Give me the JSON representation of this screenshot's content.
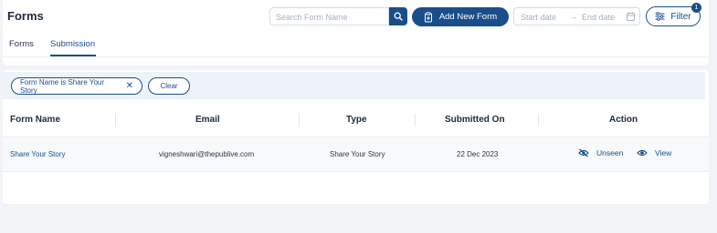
{
  "header": {
    "title": "Forms",
    "search_placeholder": "Search Form Name",
    "add_button_label": "Add New Form",
    "date_start_placeholder": "Start date",
    "date_end_placeholder": "End date",
    "filter_label": "Filter",
    "filter_count": "1"
  },
  "tabs": [
    {
      "label": "Forms",
      "active": false
    },
    {
      "label": "Submission",
      "active": true
    }
  ],
  "filters": {
    "chip_label": "Form Name is Share Your Story",
    "clear_label": "Clear"
  },
  "table": {
    "columns": [
      "Form Name",
      "Email",
      "Type",
      "Submitted On",
      "Action"
    ],
    "rows": [
      {
        "form_name": "Share Your Story",
        "email": "vigneshwari@thepublive.com",
        "type": "Share Your Story",
        "submitted_on": "22 Dec 2023",
        "unseen_label": "Unseen",
        "view_label": "View"
      }
    ]
  },
  "colors": {
    "accent": "#1a4e8a",
    "page_bg": "#f1f3f6",
    "chip_bar_bg": "#eef3f9"
  },
  "icons": [
    "search-icon",
    "add-form-icon",
    "arrow-right-icon",
    "calendar-icon",
    "filter-sliders-icon",
    "close-icon",
    "eye-slash-icon",
    "eye-icon"
  ]
}
